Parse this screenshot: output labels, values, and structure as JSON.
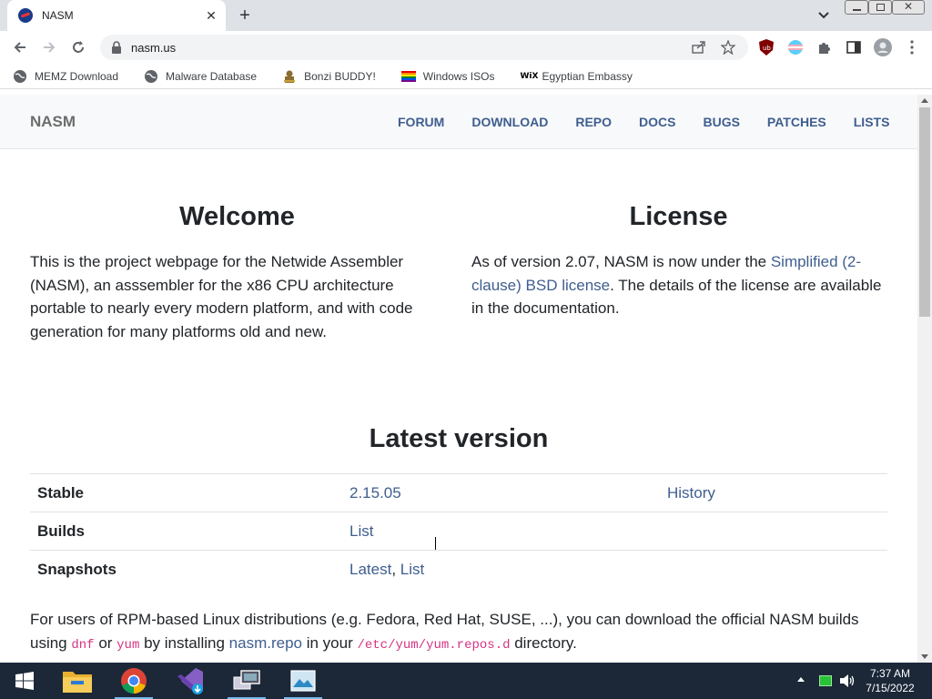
{
  "browser": {
    "tab_title": "NASM",
    "url": "nasm.us",
    "bookmarks": [
      {
        "label": "MEMZ Download",
        "icon": "globe-icon"
      },
      {
        "label": "Malware Database",
        "icon": "globe-icon"
      },
      {
        "label": "Bonzi BUDDY!",
        "icon": "bonzi-icon"
      },
      {
        "label": "Windows ISOs",
        "icon": "rainbow-flag-icon"
      },
      {
        "label": "Egyptian Embassy",
        "icon": "wix-icon"
      }
    ]
  },
  "site": {
    "brand": "NASM",
    "nav": [
      "FORUM",
      "DOWNLOAD",
      "REPO",
      "DOCS",
      "BUGS",
      "PATCHES",
      "LISTS"
    ],
    "welcome": {
      "heading": "Welcome",
      "text": "This is the project webpage for the Netwide Assembler (NASM), an asssembler for the x86 CPU architecture portable to nearly every modern platform, and with code generation for many platforms old and new."
    },
    "license": {
      "heading": "License",
      "text_before": "As of version 2.07, NASM is now under the ",
      "link": "Simplified (2-clause) BSD license",
      "text_after": ". The details of the license are available in the documentation."
    },
    "latest": {
      "heading": "Latest version",
      "rows": [
        {
          "label": "Stable",
          "value": "2.15.05",
          "extra": "History"
        },
        {
          "label": "Builds",
          "value": "List",
          "extra": ""
        },
        {
          "label": "Snapshots",
          "value_a": "Latest",
          "sep": ", ",
          "value_b": "List",
          "extra": ""
        }
      ]
    },
    "rpm": {
      "t1": "For users of RPM-based Linux distributions (e.g. Fedora, Red Hat, SUSE, ...), you can download the official NASM builds using ",
      "c1": "dnf",
      "t2": " or ",
      "c2": "yum",
      "t3": " by installing ",
      "link": "nasm.repo",
      "t4": " in your ",
      "c3": "/etc/yum/yum.repos.d",
      "t5": " directory."
    }
  },
  "taskbar": {
    "time": "7:37 AM",
    "date": "7/15/2022"
  },
  "colors": {
    "link": "#3f5e8f",
    "taskbar": "#1c2838"
  }
}
